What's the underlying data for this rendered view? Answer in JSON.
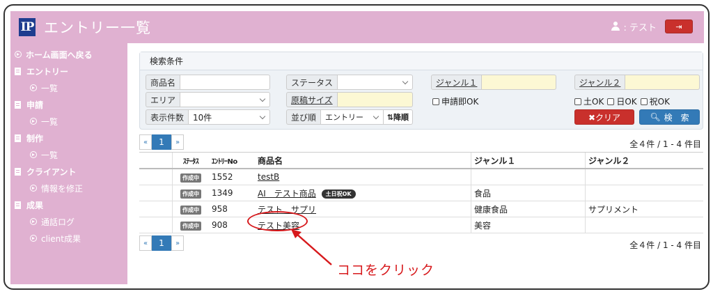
{
  "header": {
    "logo_text": "IP",
    "title": "エントリー一覧",
    "user_label": ": テスト",
    "logout_icon": "sign-out-icon"
  },
  "sidebar": {
    "items": [
      {
        "label": "ホーム画面へ戻る",
        "type": "top",
        "icon": "arrow-circle-icon"
      },
      {
        "label": "エントリー",
        "type": "top",
        "icon": "book-icon"
      },
      {
        "label": "一覧",
        "type": "sub",
        "icon": "arrow-circle-icon"
      },
      {
        "label": "申請",
        "type": "top",
        "icon": "book-icon"
      },
      {
        "label": "一覧",
        "type": "sub",
        "icon": "arrow-circle-icon"
      },
      {
        "label": "制作",
        "type": "top",
        "icon": "book-icon"
      },
      {
        "label": "一覧",
        "type": "sub",
        "icon": "arrow-circle-icon"
      },
      {
        "label": "クライアント",
        "type": "top",
        "icon": "book-icon"
      },
      {
        "label": "情報を修正",
        "type": "sub",
        "icon": "arrow-circle-icon"
      },
      {
        "label": "成果",
        "type": "top",
        "icon": "book-icon"
      },
      {
        "label": "通話ログ",
        "type": "sub",
        "icon": "arrow-circle-icon"
      },
      {
        "label": "client成果",
        "type": "sub",
        "icon": "arrow-circle-icon"
      }
    ]
  },
  "search": {
    "heading": "検索条件",
    "product_label": "商品名",
    "product_value": "",
    "status_label": "ステータス",
    "status_value": "",
    "genre1_label": "ジャンル１",
    "genre1_value": "",
    "genre2_label": "ジャンル２",
    "genre2_value": "",
    "area_label": "エリア",
    "area_value": "",
    "manuscript_label": "原稿サイズ",
    "manuscript_value": "",
    "apply_ok_label": "申請即OK",
    "sat_ok_label": "土OK",
    "sun_ok_label": "日OK",
    "holiday_ok_label": "祝OK",
    "per_page_label": "表示件数",
    "per_page_value": "10件",
    "sort_label": "並び順",
    "sort_value": "エントリー",
    "sort_dir_label": "降順",
    "clear_label": "✖クリア",
    "search_label": "検　索"
  },
  "pagination": {
    "prev": "«",
    "current": "1",
    "next": "»",
    "total_text": "全４件 / 1 - 4 件目"
  },
  "table": {
    "headers": [
      "ｽﾃｰﾀｽ",
      "ｴﾝﾄﾘｰNo",
      "商品名",
      "ジャンル１",
      "ジャンル２"
    ],
    "rows": [
      {
        "status": "作成中",
        "entry_no": "1552",
        "product": "testB",
        "badge": "",
        "genre1": "",
        "genre2": ""
      },
      {
        "status": "作成中",
        "entry_no": "1349",
        "product": "AI　テスト商品",
        "badge": "土日祝OK",
        "genre1": "食品",
        "genre2": ""
      },
      {
        "status": "作成中",
        "entry_no": "958",
        "product": "テスト　サプリ",
        "badge": "",
        "genre1": "健康食品",
        "genre2": "サプリメント"
      },
      {
        "status": "作成中",
        "entry_no": "908",
        "product": "テスト美容",
        "badge": "",
        "genre1": "美容",
        "genre2": ""
      }
    ]
  },
  "annotation": {
    "text": "ココをクリック",
    "color": "#d7191c"
  },
  "colors": {
    "accent_pink": "#e0b1d1",
    "logo_blue": "#1e3d8f",
    "danger": "#c9302c",
    "primary": "#337ab7"
  }
}
